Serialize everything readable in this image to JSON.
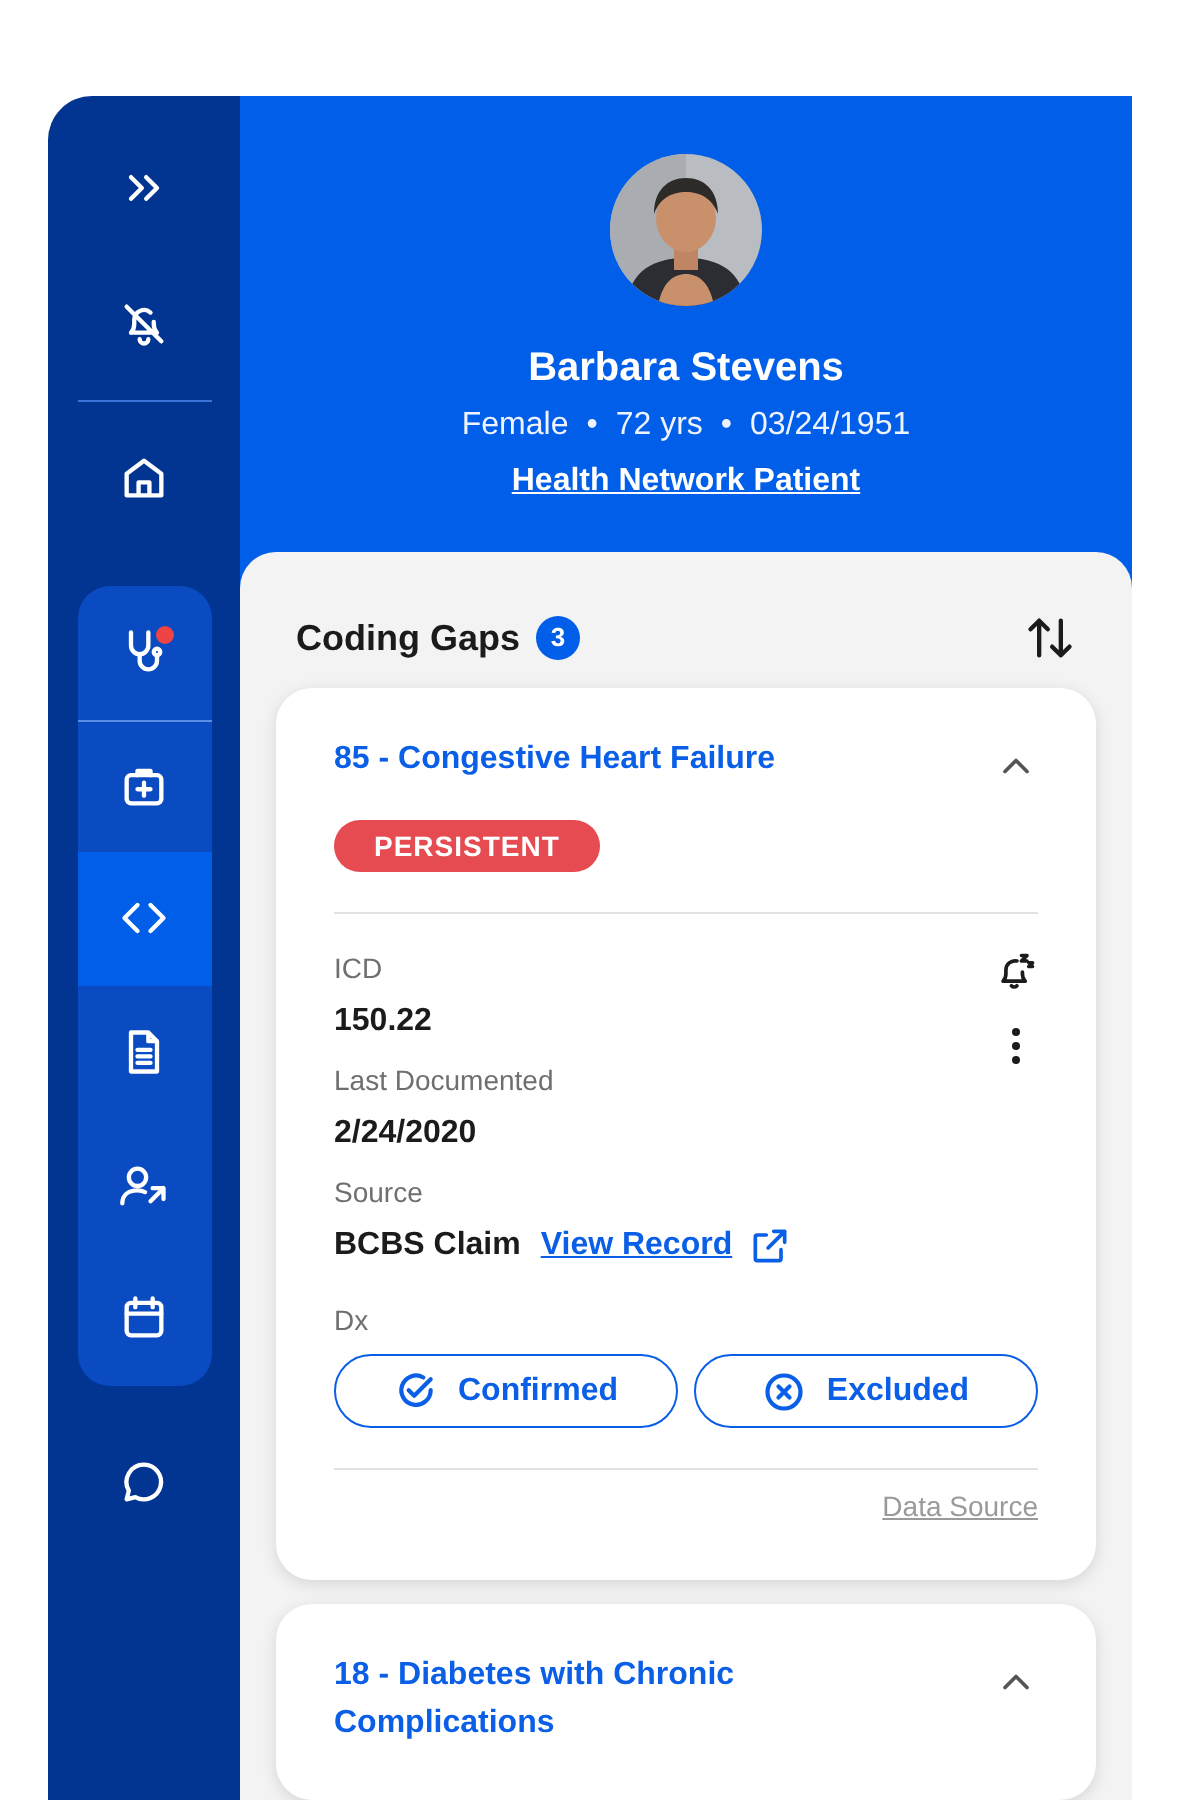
{
  "sidebar": {
    "top_items": [
      {
        "kind": "expand",
        "selected": false
      },
      {
        "kind": "bell-off",
        "selected": false
      },
      {
        "kind": "home",
        "selected": false
      }
    ],
    "group_items": [
      {
        "kind": "stethoscope",
        "selected": false,
        "notification": true
      },
      {
        "kind": "medkit",
        "selected": false,
        "notification": false
      },
      {
        "kind": "code",
        "selected": true,
        "notification": false
      },
      {
        "kind": "document",
        "selected": false,
        "notification": false
      },
      {
        "kind": "user-arrow",
        "selected": false,
        "notification": false
      },
      {
        "kind": "calendar",
        "selected": false,
        "notification": false
      }
    ],
    "bottom_items": [
      {
        "kind": "chat",
        "selected": false
      }
    ]
  },
  "patient": {
    "name": "Barbara Stevens",
    "meta": [
      "Female",
      "72 yrs",
      "03/24/1951"
    ],
    "meta_separator": "•",
    "network_link": "Health Network Patient"
  },
  "coding_gaps": {
    "title": "Coding Gaps",
    "count": "3",
    "cards": [
      {
        "title": "85 - Congestive Heart Failure",
        "expanded": true,
        "tag": "PERSISTENT",
        "fields": [
          {
            "label": "ICD",
            "value": "150.22"
          },
          {
            "label": "Last Documented",
            "value": "2/24/2020"
          },
          {
            "label": "Source",
            "value": "BCBS Claim",
            "link": "View Record"
          }
        ],
        "dx_label": "Dx",
        "dx_buttons": [
          {
            "kind": "confirm",
            "label": "Confirmed",
            "selected": false
          },
          {
            "kind": "exclude",
            "label": "Excluded",
            "selected": false
          }
        ],
        "footer_link": "Data Source"
      },
      {
        "title": "18 - Diabetes with Chronic Complications",
        "expanded": true
      }
    ]
  }
}
